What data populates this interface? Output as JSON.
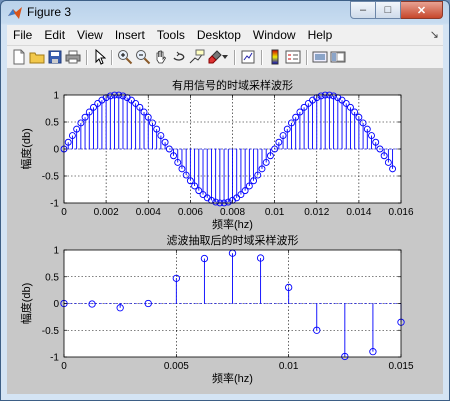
{
  "window": {
    "title": "Figure 3",
    "minimize_glyph": "–",
    "maximize_glyph": "□",
    "close_glyph": "✕"
  },
  "menu": {
    "items": [
      "File",
      "Edit",
      "View",
      "Insert",
      "Tools",
      "Desktop",
      "Window",
      "Help"
    ],
    "dock_glyph": "↘"
  },
  "toolbar": {
    "icons": [
      "new-file-icon",
      "open-folder-icon",
      "save-icon",
      "print-icon",
      "select-arrow-icon",
      "zoom-in-icon",
      "zoom-out-icon",
      "pan-hand-icon",
      "rotate-3d-icon",
      "data-cursor-icon",
      "brush-icon",
      "brush-dropdown-icon",
      "link-plot-icon",
      "colorbar-icon",
      "legend-icon",
      "hide-plot-tools-icon",
      "show-plot-tools-icon"
    ]
  },
  "colors": {
    "stem": "#0000ff",
    "axes_bg": "#ffffff",
    "figure_bg": "#c8c8c8"
  },
  "chart_data": [
    {
      "type": "stem",
      "title": "有用信号的时域采样波形",
      "xlabel": "频率(hz)",
      "ylabel": "幅度(db)",
      "xlim": [
        0,
        0.016
      ],
      "ylim": [
        -1,
        1
      ],
      "xticks": [
        0,
        0.002,
        0.004,
        0.006,
        0.008,
        0.01,
        0.012,
        0.014,
        0.016
      ],
      "xtick_labels": [
        "0",
        "0.002",
        "0.004",
        "0.006",
        "0.008",
        "0.01",
        "0.012",
        "0.014",
        "0.016"
      ],
      "yticks": [
        -1,
        -0.5,
        0,
        0.5,
        1
      ],
      "ytick_labels": [
        "-1",
        "-0.5",
        "0",
        "0.5",
        "1"
      ],
      "grid": true,
      "series": [
        {
          "x_start": 0,
          "x_step": 0.0002,
          "count": 79,
          "values": [
            0,
            0.125,
            0.249,
            0.368,
            0.482,
            0.588,
            0.685,
            0.771,
            0.844,
            0.905,
            0.951,
            0.982,
            0.998,
            0.998,
            0.982,
            0.951,
            0.905,
            0.844,
            0.771,
            0.685,
            0.588,
            0.482,
            0.368,
            0.249,
            0.125,
            0,
            -0.125,
            -0.249,
            -0.368,
            -0.482,
            -0.588,
            -0.685,
            -0.771,
            -0.844,
            -0.905,
            -0.951,
            -0.982,
            -0.998,
            -0.998,
            -0.982,
            -0.951,
            -0.905,
            -0.844,
            -0.771,
            -0.685,
            -0.588,
            -0.482,
            -0.368,
            -0.249,
            -0.125,
            0,
            0.125,
            0.249,
            0.368,
            0.482,
            0.588,
            0.685,
            0.771,
            0.844,
            0.905,
            0.951,
            0.982,
            0.998,
            0.998,
            0.982,
            0.951,
            0.905,
            0.844,
            0.771,
            0.685,
            0.588,
            0.482,
            0.368,
            0.249,
            0.125,
            0,
            -0.125,
            -0.249,
            -0.368
          ]
        }
      ]
    },
    {
      "type": "stem",
      "title": "滤波抽取后的时域采样波形",
      "xlabel": "频率(hz)",
      "ylabel": "幅度(db)",
      "xlim": [
        0,
        0.015
      ],
      "ylim": [
        -1,
        1
      ],
      "xticks": [
        0,
        0.005,
        0.01,
        0.015
      ],
      "xtick_labels": [
        "0",
        "0.005",
        "0.01",
        "0.015"
      ],
      "yticks": [
        -1,
        -0.5,
        0,
        0.5,
        1
      ],
      "ytick_labels": [
        "-1",
        "-0.5",
        "0",
        "0.5",
        "1"
      ],
      "grid": true,
      "series": [
        {
          "x": [
            0,
            0.00125,
            0.0025,
            0.00375,
            0.005,
            0.00625,
            0.0075,
            0.00875,
            0.01,
            0.01125,
            0.0125,
            0.01375,
            0.015
          ],
          "values": [
            0,
            -0.01,
            -0.08,
            0,
            0.47,
            0.84,
            0.94,
            0.85,
            0.3,
            -0.5,
            -0.99,
            -0.9,
            -0.35
          ]
        }
      ]
    }
  ]
}
